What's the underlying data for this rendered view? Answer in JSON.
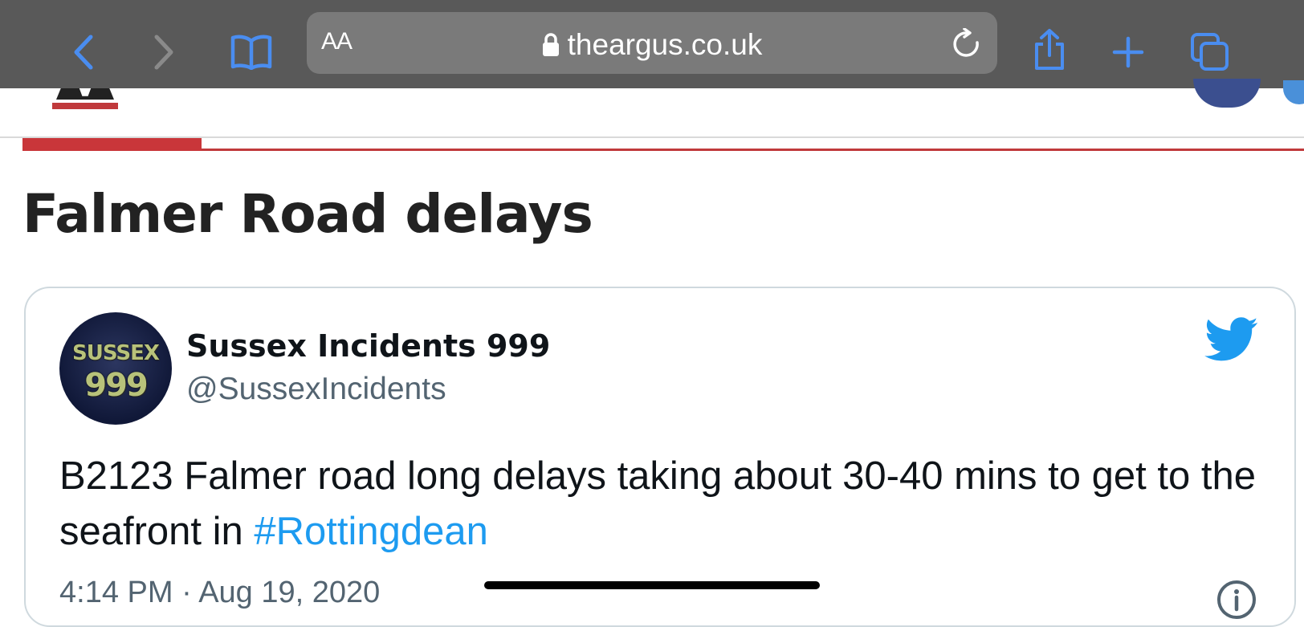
{
  "browser": {
    "text_size_label": "AA",
    "url": "theargus.co.uk",
    "icons": {
      "back": "chevron-left-icon",
      "forward": "chevron-right-icon",
      "bookmarks": "book-icon",
      "lock": "lock-icon",
      "reload": "reload-icon",
      "share": "share-icon",
      "new_tab": "plus-icon",
      "tabs": "tabs-icon"
    },
    "accent_color": "#4a8df0"
  },
  "article": {
    "headline": "Falmer Road delays",
    "reading_progress": 0.14
  },
  "tweet": {
    "avatar_text_top": "SUSSEX",
    "avatar_text_bottom": "999",
    "author_name": "Sussex Incidents 999",
    "handle": "@SussexIncidents",
    "text_before": "B2123 Falmer road long delays taking about 30-40 mins to get to the seafront in ",
    "hashtag": "#Rottingdean",
    "timestamp": "4:14 PM · Aug 19, 2020",
    "icons": {
      "brand": "twitter-bird-icon",
      "info": "info-icon"
    },
    "link_color": "#1d9bf0"
  }
}
